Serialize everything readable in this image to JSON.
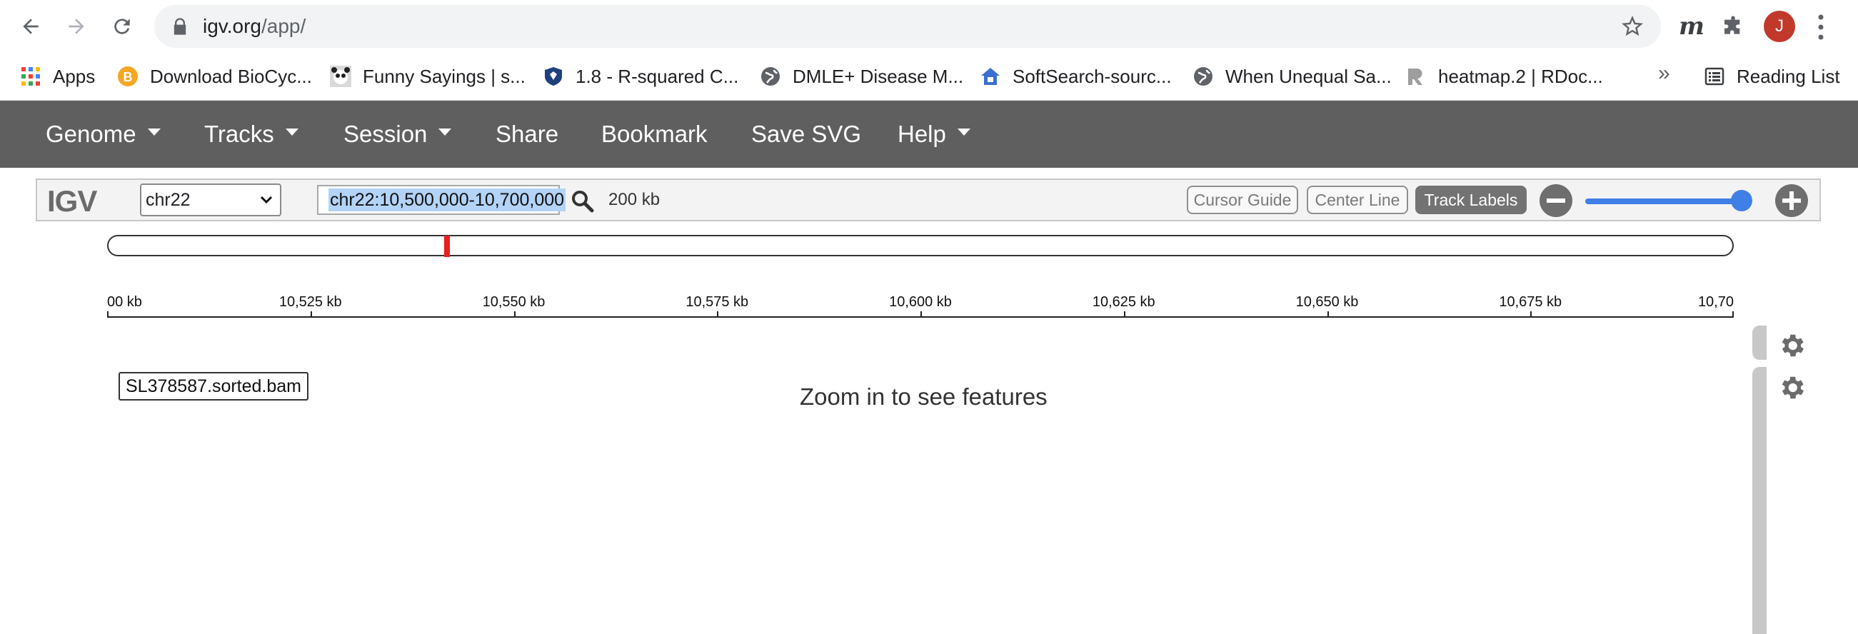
{
  "browser": {
    "url_host": "igv.org",
    "url_path": "/app/",
    "avatar_letter": "J",
    "extension_m": "m",
    "bookmarks": [
      {
        "label": "Apps",
        "icon": "apps-grid-icon"
      },
      {
        "label": "Download BioCyc...",
        "icon": "biocyc-icon"
      },
      {
        "label": "Funny Sayings | s...",
        "icon": "panda-icon"
      },
      {
        "label": "1.8 - R-squared C...",
        "icon": "psu-shield-icon"
      },
      {
        "label": "DMLE+ Disease M...",
        "icon": "globe-icon"
      },
      {
        "label": "SoftSearch-sourc...",
        "icon": "house-icon"
      },
      {
        "label": "When Unequal Sa...",
        "icon": "globe-icon"
      },
      {
        "label": "heatmap.2 | RDoc...",
        "icon": "rdoc-icon"
      }
    ],
    "more_bookmarks": "»",
    "reading_list": "Reading List"
  },
  "app_nav": {
    "items": [
      {
        "label": "Genome",
        "dropdown": true
      },
      {
        "label": "Tracks",
        "dropdown": true
      },
      {
        "label": "Session",
        "dropdown": true
      },
      {
        "label": "Share",
        "dropdown": false
      },
      {
        "label": "Bookmark",
        "dropdown": false
      },
      {
        "label": "Save SVG",
        "dropdown": false
      },
      {
        "label": "Help",
        "dropdown": true
      }
    ]
  },
  "controls": {
    "logo": "IGV",
    "chromosome": "chr22",
    "locus": "chr22:10,500,000-10,700,000",
    "span": "200 kb",
    "cursor_guide": "Cursor Guide",
    "center_line": "Center Line",
    "track_labels": "Track Labels",
    "zoom_level": 0.95
  },
  "ideogram": {
    "region_fraction": 0.207
  },
  "ruler": {
    "ticks": [
      "00 kb",
      "10,525 kb",
      "10,550 kb",
      "10,575 kb",
      "10,600 kb",
      "10,625 kb",
      "10,650 kb",
      "10,675 kb",
      "10,70"
    ]
  },
  "track": {
    "name": "SL378587.sorted.bam",
    "message": "Zoom in to see features"
  },
  "colors": {
    "navbar": "#5f5f5f",
    "slider": "#3f7fe6",
    "ideogram_marker": "#e62020",
    "avatar": "#c0392b"
  }
}
